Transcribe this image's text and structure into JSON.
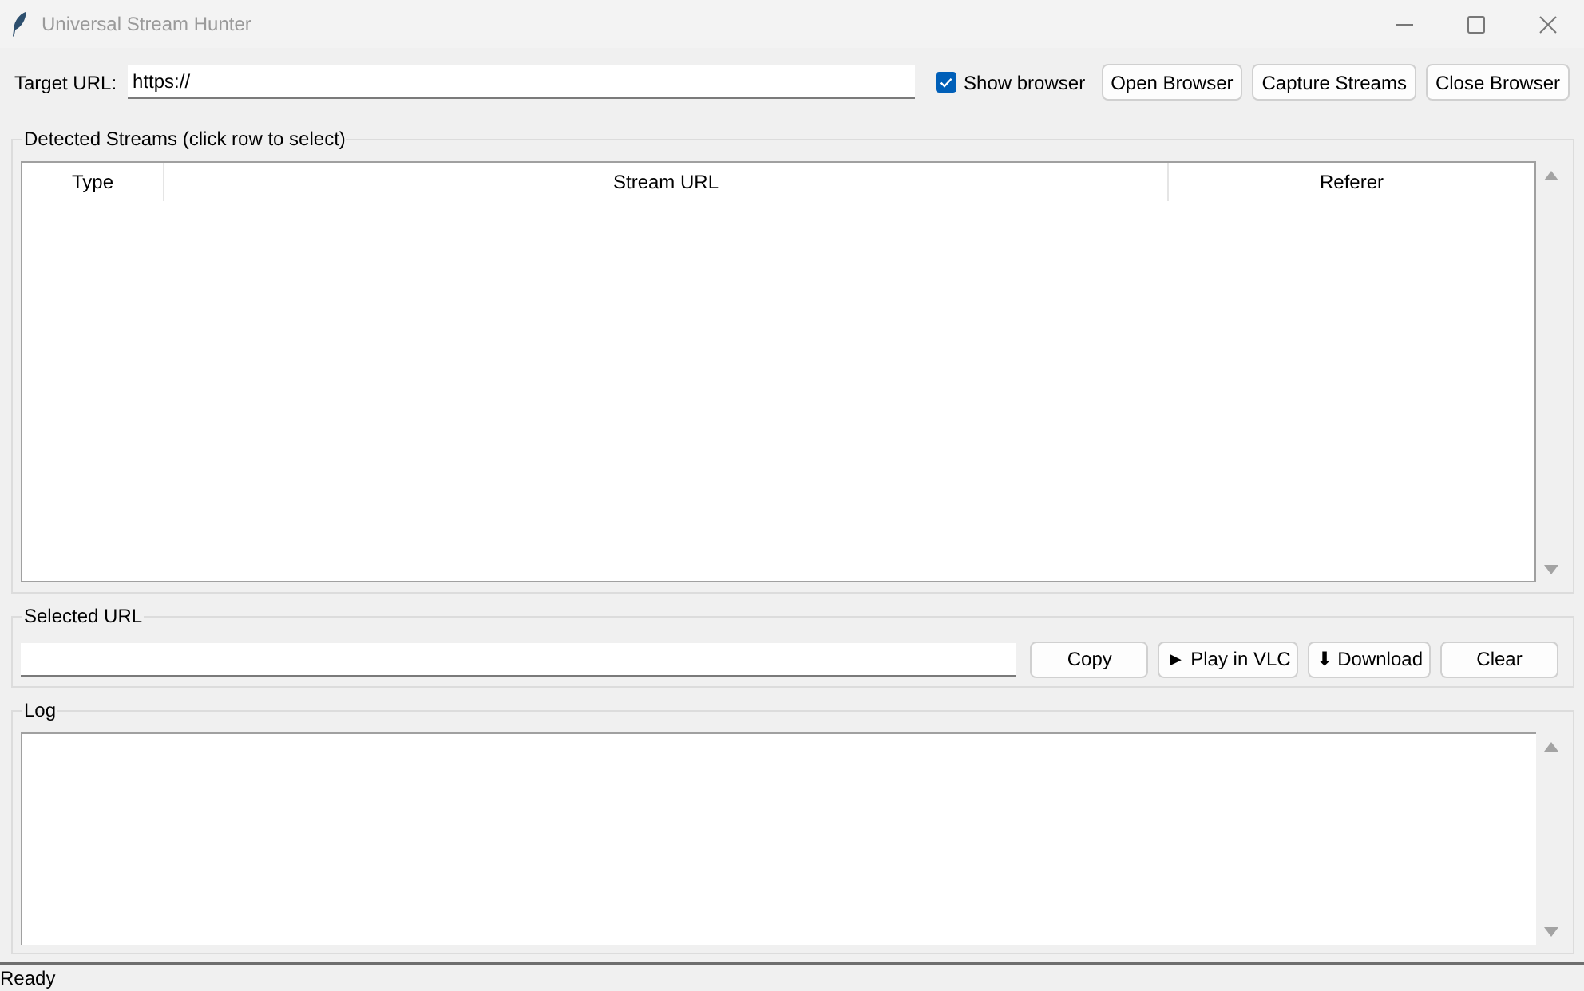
{
  "window": {
    "title": "Universal Stream Hunter"
  },
  "url_bar": {
    "label": "Target URL:",
    "value": "https://",
    "show_browser": {
      "label": "Show browser",
      "checked": true
    },
    "buttons": [
      "Open Browser",
      "Capture Streams",
      "Close Browser"
    ]
  },
  "streams": {
    "title": "Detected Streams (click row to select)",
    "columns": [
      "Type",
      "Stream URL",
      "Referer"
    ]
  },
  "selected_url": {
    "title": "Selected URL",
    "buttons": [
      "Copy",
      "► Play in VLC",
      "⬇ Download",
      "Clear"
    ]
  },
  "log": {
    "title": "Log"
  },
  "status_bar": {
    "text": "Ready"
  }
}
